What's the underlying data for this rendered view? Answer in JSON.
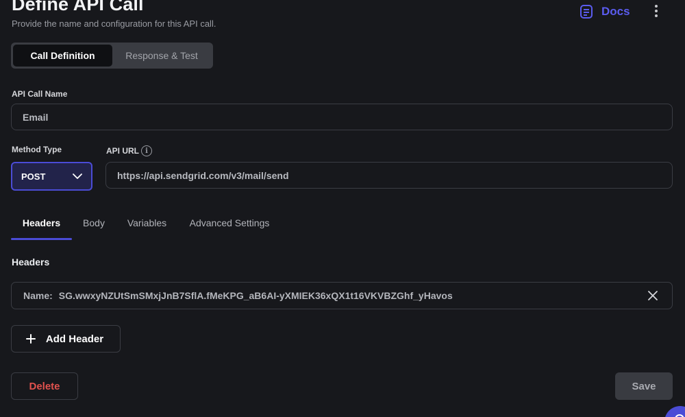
{
  "header": {
    "title": "Define API Call",
    "subtitle": "Provide the name and configuration for this API call.",
    "docs_label": "Docs"
  },
  "segmented": {
    "items": [
      {
        "label": "Call Definition",
        "active": true
      },
      {
        "label": "Response & Test",
        "active": false
      }
    ]
  },
  "form": {
    "call_name_label": "API Call Name",
    "call_name_value": "Email",
    "method_label": "Method Type",
    "method_value": "POST",
    "url_label": "API URL",
    "url_value": "https://api.sendgrid.com/v3/mail/send"
  },
  "tabs": [
    {
      "label": "Headers",
      "active": true
    },
    {
      "label": "Body",
      "active": false
    },
    {
      "label": "Variables",
      "active": false
    },
    {
      "label": "Advanced Settings",
      "active": false
    }
  ],
  "headers_section": {
    "title": "Headers",
    "rows": [
      {
        "name_label": "Name:",
        "value": "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"
      }
    ],
    "add_label": "Add Header"
  },
  "actions": {
    "delete_label": "Delete",
    "save_label": "Save"
  },
  "colors": {
    "accent": "#4b4cd6",
    "docs": "#5b5cf0",
    "danger": "#e2524e",
    "background": "#17181c"
  },
  "icons": {
    "docs": "document-icon",
    "more": "more-vertical-icon",
    "info": "info-icon",
    "select": "chevron-down-icon",
    "remove": "close-icon",
    "add": "plus-icon"
  }
}
